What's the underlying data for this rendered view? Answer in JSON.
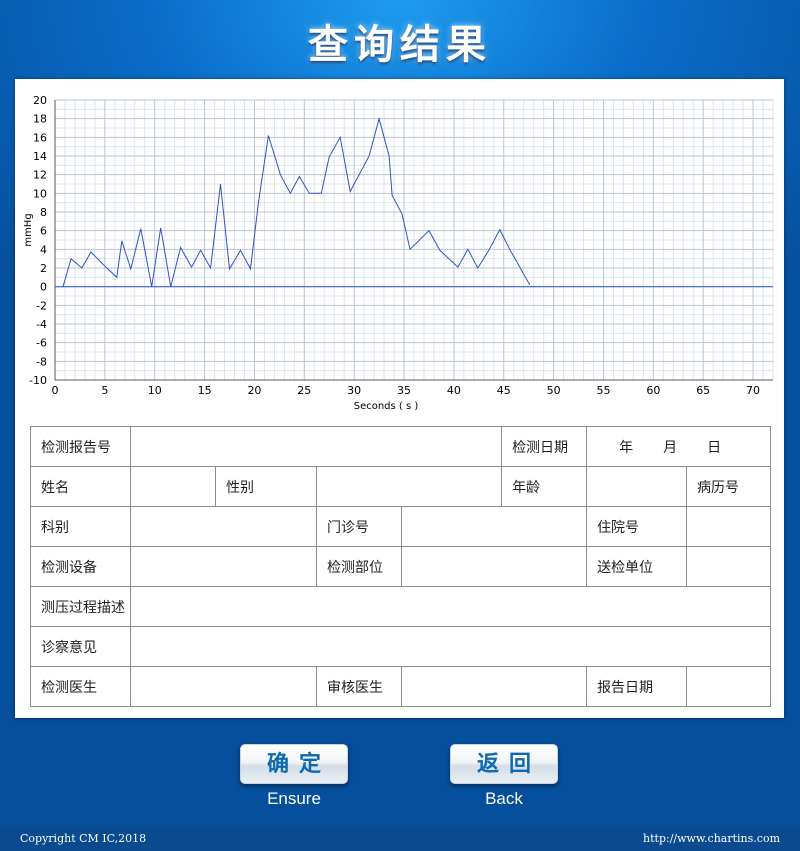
{
  "title": "查询结果",
  "chart_data": {
    "type": "line",
    "xlabel": "Seconds ( s )",
    "ylabel": "mmHg",
    "xlim": [
      0,
      72
    ],
    "ylim": [
      -10,
      20
    ],
    "x_ticks": [
      0,
      5,
      10,
      15,
      20,
      25,
      30,
      35,
      40,
      45,
      50,
      55,
      60,
      65,
      70
    ],
    "y_ticks": [
      20,
      18,
      16,
      14,
      12,
      10,
      8,
      6,
      4,
      2,
      0,
      -2,
      -4,
      -6,
      -8,
      -10
    ],
    "grid": true,
    "line_color": "#2a55c8",
    "series": [
      {
        "x": [
          0.8,
          1.6,
          2.7,
          3.6,
          5,
          6.2,
          6.7,
          7.6,
          8.6,
          9.7,
          10.6,
          11.6,
          12.6,
          13.7,
          14.6,
          15.6,
          16.6,
          17.5,
          18.6,
          19.6,
          20.4,
          21.4,
          22.6,
          23.6,
          24.5,
          25.5,
          26.7,
          27.5,
          28.6,
          29.6,
          31.5,
          32.5,
          33.5,
          33.8,
          34.8,
          35.6,
          37.5,
          38.6,
          40.4,
          41.4,
          42.4,
          43.5,
          44.6,
          45.6,
          47.6
        ],
        "y": [
          0,
          3,
          2,
          3.7,
          2.2,
          1,
          4.9,
          1.9,
          6.2,
          0,
          6.3,
          0,
          4.2,
          2.1,
          3.9,
          2,
          11,
          1.9,
          3.9,
          1.9,
          9,
          16.2,
          12,
          10,
          11.8,
          10,
          10,
          13.9,
          16,
          10.2,
          14,
          18,
          14,
          9.8,
          7.8,
          4,
          6,
          3.9,
          2.1,
          4,
          2,
          3.9,
          6.1,
          4,
          0.2
        ]
      },
      {
        "x": [
          0,
          72
        ],
        "y": [
          0,
          0
        ]
      }
    ]
  },
  "form": {
    "report_no_label": "检测报告号",
    "report_no_value": "",
    "test_date_label": "检测日期",
    "date_year": "年",
    "date_month": "月",
    "date_day": "日",
    "name_label": "姓名",
    "name_value": "",
    "gender_label": "性别",
    "gender_value": "",
    "age_label": "年龄",
    "age_value": "",
    "medical_record_label": "病历号",
    "medical_record_value": "",
    "department_label": "科别",
    "department_value": "",
    "outpatient_label": "门诊号",
    "outpatient_value": "",
    "inpatient_label": "住院号",
    "inpatient_value": "",
    "device_label": "检测设备",
    "device_value": "",
    "site_label": "检测部位",
    "site_value": "",
    "sending_unit_label": "送检单位",
    "sending_unit_value": "",
    "process_desc_label": "测压过程描述",
    "process_desc_value": "",
    "diagnosis_label": "诊察意见",
    "diagnosis_value": "",
    "doctor_label": "检测医生",
    "doctor_value": "",
    "reviewer_label": "审核医生",
    "reviewer_value": "",
    "report_date_label": "报告日期",
    "report_date_value": ""
  },
  "buttons": {
    "confirm_label": "确定",
    "confirm_sub": "Ensure",
    "back_label": "返回",
    "back_sub": "Back"
  },
  "footer": {
    "copyright": "Copyright CM IC,2018",
    "url": "http://www.chartins.com"
  }
}
